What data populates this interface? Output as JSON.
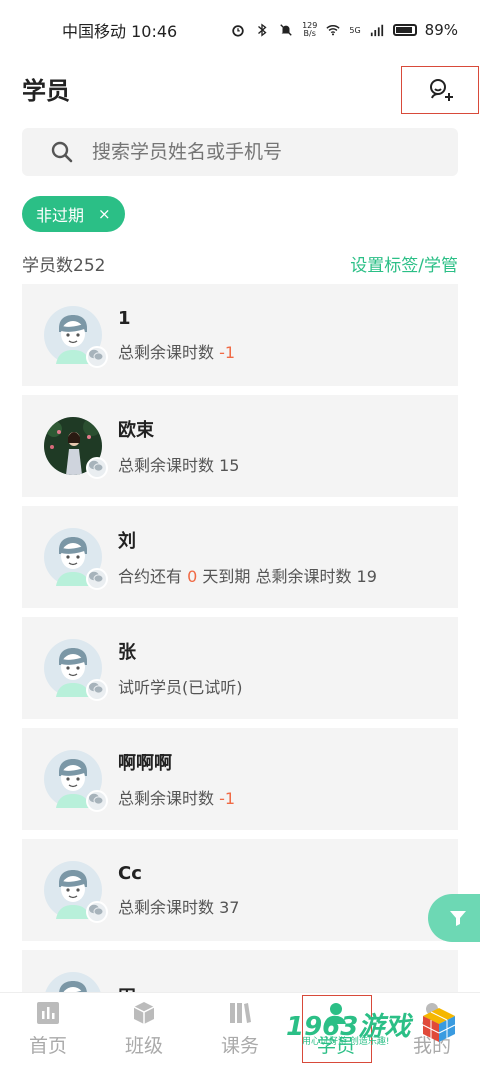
{
  "status_bar": {
    "carrier_time": "中国移动 10:46",
    "net_speed_top": "129",
    "net_speed_bottom": "B/s",
    "signal": "5G",
    "battery": "89%"
  },
  "header": {
    "title": "学员"
  },
  "search": {
    "placeholder": "搜索学员姓名或手机号"
  },
  "filter": {
    "chip_label": "非过期",
    "chip_close": "×"
  },
  "summary": {
    "student_count": "学员数252",
    "settings_link": "设置标签/学管"
  },
  "students": [
    {
      "name": "1",
      "d1": "总剩余课时数 ",
      "d2": "-1",
      "d3": "",
      "photo": false
    },
    {
      "name": "欧束",
      "d1": "总剩余课时数 15",
      "d2": "",
      "d3": "",
      "photo": true
    },
    {
      "name": "刘",
      "d1": "合约还有 ",
      "d2": "0",
      "d3": " 天到期 总剩余课时数 19",
      "photo": false
    },
    {
      "name": "张",
      "d1": "试听学员(已试听)",
      "d2": "",
      "d3": "",
      "photo": false
    },
    {
      "name": "啊啊啊",
      "d1": "总剩余课时数 ",
      "d2": "-1",
      "d3": "",
      "photo": false
    },
    {
      "name": "Cc",
      "d1": "总剩余课时数 37",
      "d2": "",
      "d3": "",
      "photo": false
    },
    {
      "name": "田",
      "d1": "",
      "d2": "",
      "d3": "",
      "photo": false
    }
  ],
  "nav": {
    "home": "首页",
    "class": "班级",
    "course": "课务",
    "students": "学员",
    "mine": "我的"
  },
  "watermark": {
    "text": "1963游戏",
    "sub": "用心玩好游 创造乐趣!"
  },
  "colors": {
    "accent": "#2bbf86",
    "highlight": "#f06a45",
    "outline": "#d84a3a"
  }
}
